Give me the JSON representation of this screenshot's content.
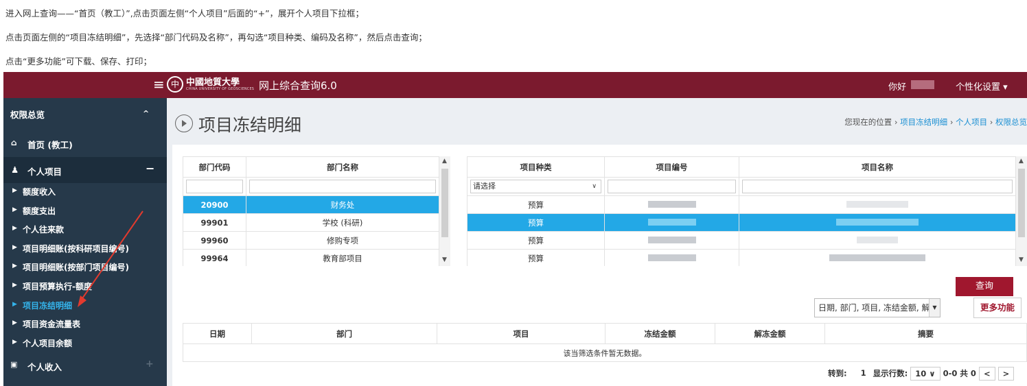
{
  "instructions": [
    "进入网上查询——“首页（教工）”,点击页面左侧“个人项目”后面的“+”，展开个人项目下拉框；",
    "点击页面左侧的“项目冻结明细”，先选择“部门代码及名称”，再勾选“项目种类、编码及名称”，然后点击查询；",
    "点击“更多功能”可下载、保存、打印；"
  ],
  "topbar": {
    "menu_icon": "≡",
    "logo_glyph": "中",
    "school_cn": "中國地質大學",
    "school_en": "CHINA UNIVERSITY OF GEOSCIENCES",
    "system_title": "网上综合查询6.0",
    "greeting": "你好",
    "settings_label": "个性化设置 ▾"
  },
  "sidebar": {
    "sections": [
      {
        "label": "权限总览",
        "toggle": "^"
      },
      {
        "label": "首页 (教工)",
        "icon": "⌂"
      },
      {
        "label": "个人项目",
        "icon": "♟",
        "toggle": "−"
      }
    ],
    "items": [
      "额度收入",
      "额度支出",
      "个人往来款",
      "项目明细账(按科研项目编号)",
      "项目明细账(按部门项目编号)",
      "项目预算执行-额度",
      "项目冻结明细",
      "项目资金流量表",
      "个人项目余额"
    ],
    "active_item": "项目冻结明细",
    "bottom": {
      "label": "个人收入",
      "icon": "▣",
      "toggle": "+"
    }
  },
  "page": {
    "title": "项目冻结明细",
    "breadcrumb_prefix": "您现在的位置",
    "breadcrumb": [
      "项目冻结明细",
      "个人项目",
      "权限总览"
    ],
    "breadcrumb_sep": "›"
  },
  "dept_table": {
    "headers": [
      "部门代码",
      "部门名称"
    ],
    "rows": [
      {
        "code": "20900",
        "name": "财务处"
      },
      {
        "code": "99901",
        "name": "学校 (科研)"
      },
      {
        "code": "99960",
        "name": "修购专项"
      },
      {
        "code": "99964",
        "name": "教育部项目"
      }
    ],
    "selected_index": 0
  },
  "project_table": {
    "headers": [
      "项目种类",
      "项目编号",
      "项目名称"
    ],
    "type_filter": "请选择",
    "rows": [
      {
        "type": "预算"
      },
      {
        "type": "预算"
      },
      {
        "type": "预算"
      },
      {
        "type": "预算"
      }
    ],
    "selected_index": 1
  },
  "actions": {
    "query_label": "查询",
    "columns_value": "日期, 部门, 项目, 冻结金额, 解",
    "more_label": "更多功能"
  },
  "result_table": {
    "headers": [
      "日期",
      "部门",
      "项目",
      "冻结金额",
      "解冻金额",
      "摘要"
    ],
    "empty_message": "该当筛选条件暂无数据。"
  },
  "pager": {
    "goto_label": "转到:",
    "page": "1",
    "rows_label": "显示行数:",
    "rows_per_page": "10 ∨",
    "range": "0-0 共 0",
    "prev": "<",
    "next": ">"
  },
  "colors": {
    "topbar": "#7b1a2e",
    "sidebar": "#26394a",
    "active_link": "#34b3ea",
    "selection": "#23a8e6",
    "query_button": "#a0172e"
  }
}
